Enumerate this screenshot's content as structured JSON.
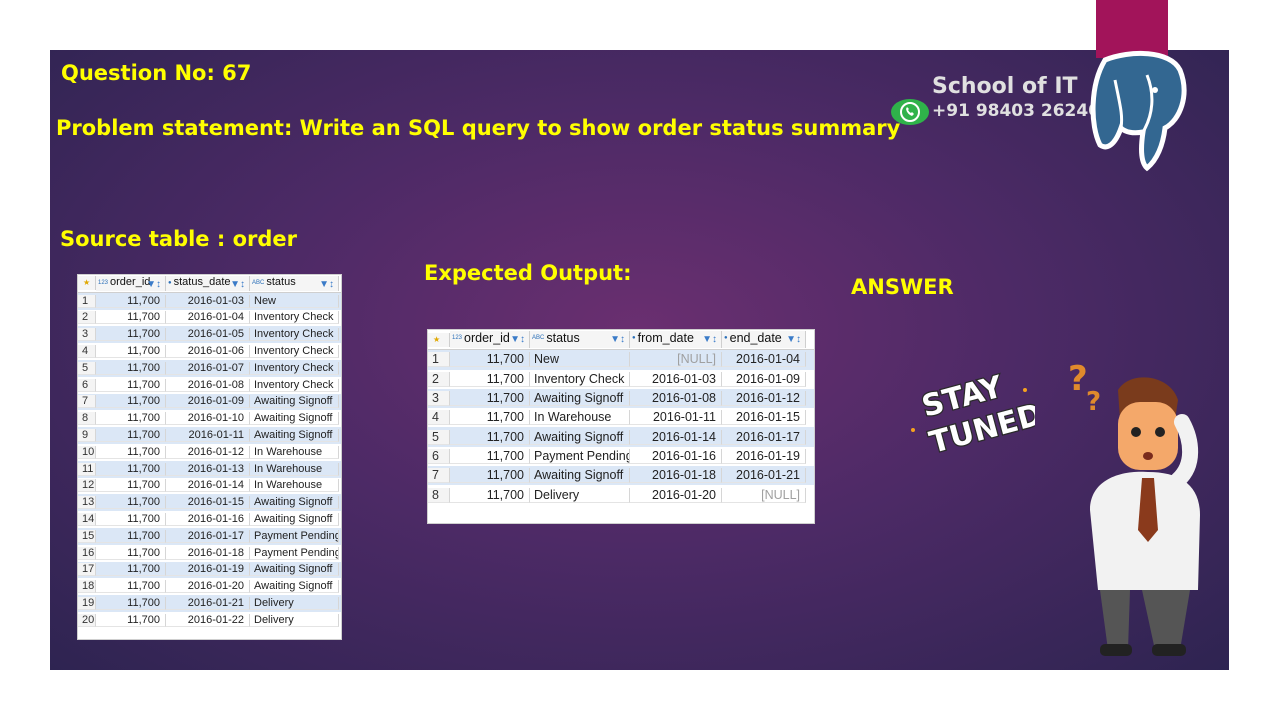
{
  "slide": {
    "question": "Question No: 67",
    "problem": "Problem statement: Write an SQL query to show order status summary",
    "source_label": "Source table : order",
    "expected_label": "Expected Output:",
    "answer_label": "ANSWER",
    "school": "School of IT",
    "phone": "+91 98403 26240",
    "stay_tuned": [
      "STAY",
      "TUNED"
    ]
  },
  "colors": {
    "title_yellow": "#ffff00",
    "selected_row": "#dbe7f6",
    "postgres_pink": "#a2145a"
  },
  "icons": {
    "header_star": "star-icon",
    "column_filter": "filter-sort-icon",
    "whatsapp": "whatsapp-icon",
    "postgres": "postgres-elephant-logo"
  },
  "source_table": {
    "type_icons": [
      "123",
      "clock",
      "ABC"
    ],
    "columns": [
      "order_id",
      "status_date",
      "status"
    ],
    "rows": [
      [
        "1",
        "11,700",
        "2016-01-03",
        "New"
      ],
      [
        "2",
        "11,700",
        "2016-01-04",
        "Inventory Check"
      ],
      [
        "3",
        "11,700",
        "2016-01-05",
        "Inventory Check"
      ],
      [
        "4",
        "11,700",
        "2016-01-06",
        "Inventory Check"
      ],
      [
        "5",
        "11,700",
        "2016-01-07",
        "Inventory Check"
      ],
      [
        "6",
        "11,700",
        "2016-01-08",
        "Inventory Check"
      ],
      [
        "7",
        "11,700",
        "2016-01-09",
        "Awaiting Signoff"
      ],
      [
        "8",
        "11,700",
        "2016-01-10",
        "Awaiting Signoff"
      ],
      [
        "9",
        "11,700",
        "2016-01-11",
        "Awaiting Signoff"
      ],
      [
        "10",
        "11,700",
        "2016-01-12",
        "In Warehouse"
      ],
      [
        "11",
        "11,700",
        "2016-01-13",
        "In Warehouse"
      ],
      [
        "12",
        "11,700",
        "2016-01-14",
        "In Warehouse"
      ],
      [
        "13",
        "11,700",
        "2016-01-15",
        "Awaiting Signoff"
      ],
      [
        "14",
        "11,700",
        "2016-01-16",
        "Awaiting Signoff"
      ],
      [
        "15",
        "11,700",
        "2016-01-17",
        "Payment Pending"
      ],
      [
        "16",
        "11,700",
        "2016-01-18",
        "Payment Pending"
      ],
      [
        "17",
        "11,700",
        "2016-01-19",
        "Awaiting Signoff"
      ],
      [
        "18",
        "11,700",
        "2016-01-20",
        "Awaiting Signoff"
      ],
      [
        "19",
        "11,700",
        "2016-01-21",
        "Delivery"
      ],
      [
        "20",
        "11,700",
        "2016-01-22",
        "Delivery"
      ]
    ]
  },
  "output_table": {
    "type_icons": [
      "123",
      "ABC",
      "clock",
      "clock"
    ],
    "columns": [
      "order_id",
      "status",
      "from_date",
      "end_date"
    ],
    "rows": [
      [
        "1",
        "11,700",
        "New",
        "[NULL]",
        "2016-01-04"
      ],
      [
        "2",
        "11,700",
        "Inventory Check",
        "2016-01-03",
        "2016-01-09"
      ],
      [
        "3",
        "11,700",
        "Awaiting Signoff",
        "2016-01-08",
        "2016-01-12"
      ],
      [
        "4",
        "11,700",
        "In Warehouse",
        "2016-01-11",
        "2016-01-15"
      ],
      [
        "5",
        "11,700",
        "Awaiting Signoff",
        "2016-01-14",
        "2016-01-17"
      ],
      [
        "6",
        "11,700",
        "Payment Pending",
        "2016-01-16",
        "2016-01-19"
      ],
      [
        "7",
        "11,700",
        "Awaiting Signoff",
        "2016-01-18",
        "2016-01-21"
      ],
      [
        "8",
        "11,700",
        "Delivery",
        "2016-01-20",
        "[NULL]"
      ]
    ]
  }
}
